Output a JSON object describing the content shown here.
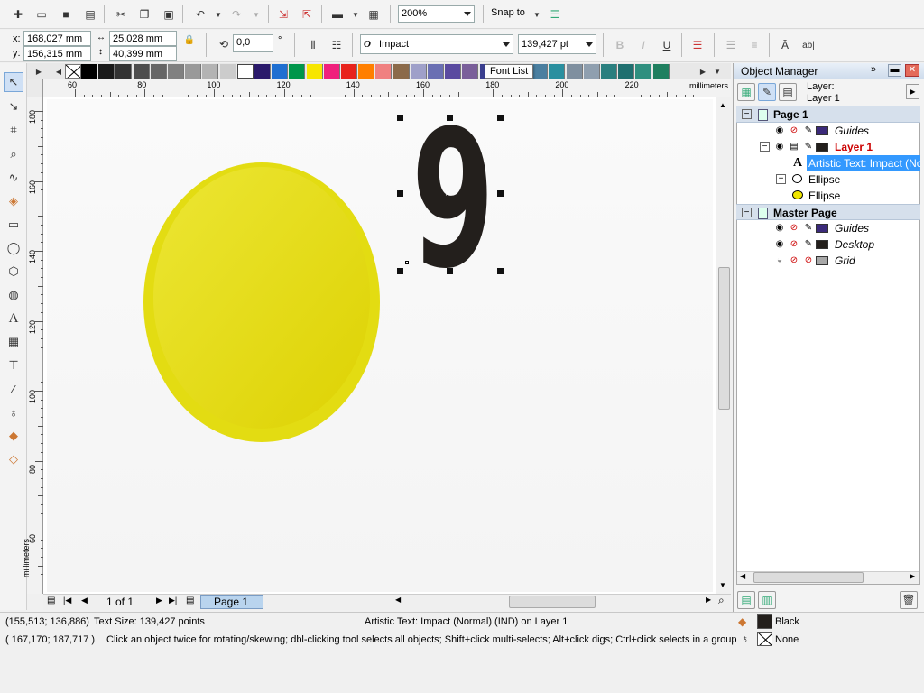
{
  "toolbar": {
    "zoom_value": "200%",
    "snap_label": "Snap to"
  },
  "property_bar": {
    "x_label": "x:",
    "x_value": "168,027 mm",
    "y_label": "y:",
    "y_value": "156,315 mm",
    "width_value": "25,028 mm",
    "height_value": "40,399 mm",
    "rotation_value": "0,0",
    "rotation_unit": "°",
    "font_name": "Impact",
    "font_icon": "O",
    "font_size": "139,427 pt",
    "tooltip": "Font List"
  },
  "palette": {
    "colors": [
      "#000000",
      "#1a1a1a",
      "#333333",
      "#4d4d4d",
      "#666666",
      "#808080",
      "#999999",
      "#b3b3b3",
      "#cccccc",
      "#ffffff",
      "#2b1a6b",
      "#1f6fd1",
      "#00964b",
      "#f7e600",
      "#f0207c",
      "#e8231c",
      "#ff7f00",
      "#f08080",
      "#8b6a4a",
      "#9fa0c9",
      "#6a6fb3",
      "#5a4aa0",
      "#7a5f9a",
      "#3a3f8f",
      "#5f4a7a",
      "#5a5aa5",
      "#4a7fa0",
      "#2a8f9f",
      "#7f8f9f",
      "#8f9faf",
      "#2a7f7f",
      "#1f6f6f",
      "#2f8f7f",
      "#1f7f5f"
    ]
  },
  "ruler": {
    "unit": "millimeters",
    "h_ticks": [
      "60",
      "80",
      "100",
      "120",
      "140",
      "160",
      "180",
      "200",
      "220"
    ],
    "v_ticks": [
      "180",
      "160",
      "140",
      "120",
      "100",
      "80",
      "60"
    ],
    "v_unit": "millimeters"
  },
  "canvas": {
    "glyph": "9"
  },
  "page_nav": {
    "count": "1 of 1",
    "tab": "Page 1"
  },
  "status": {
    "coords": "(155,513; 136,886)",
    "text_size": "Text Size: 139,427 points",
    "object_info": "Artistic Text: Impact (Normal) (IND) on Layer 1",
    "cursor_coords": "( 167,170; 187,717 )",
    "hint": "Click an object twice for rotating/skewing; dbl-clicking tool selects all objects; Shift+click multi-selects; Alt+click digs; Ctrl+click selects in a group",
    "fill_label": "Black",
    "outline_label": "None"
  },
  "object_manager": {
    "title": "Object Manager",
    "layer_label": "Layer:",
    "layer_value": "Layer 1",
    "page1": "Page 1",
    "guides": "Guides",
    "layer1": "Layer 1",
    "artistic_text": "Artistic Text: Impact (No",
    "ellipse1": "Ellipse",
    "ellipse2": "Ellipse",
    "master_page": "Master Page",
    "guides2": "Guides",
    "desktop": "Desktop",
    "grid": "Grid"
  },
  "colors": {
    "ellipse_fill": "#e8e01a",
    "glyph_fill": "#231f1c",
    "selection": "#3399ff",
    "layer_red": "#cc0000"
  }
}
